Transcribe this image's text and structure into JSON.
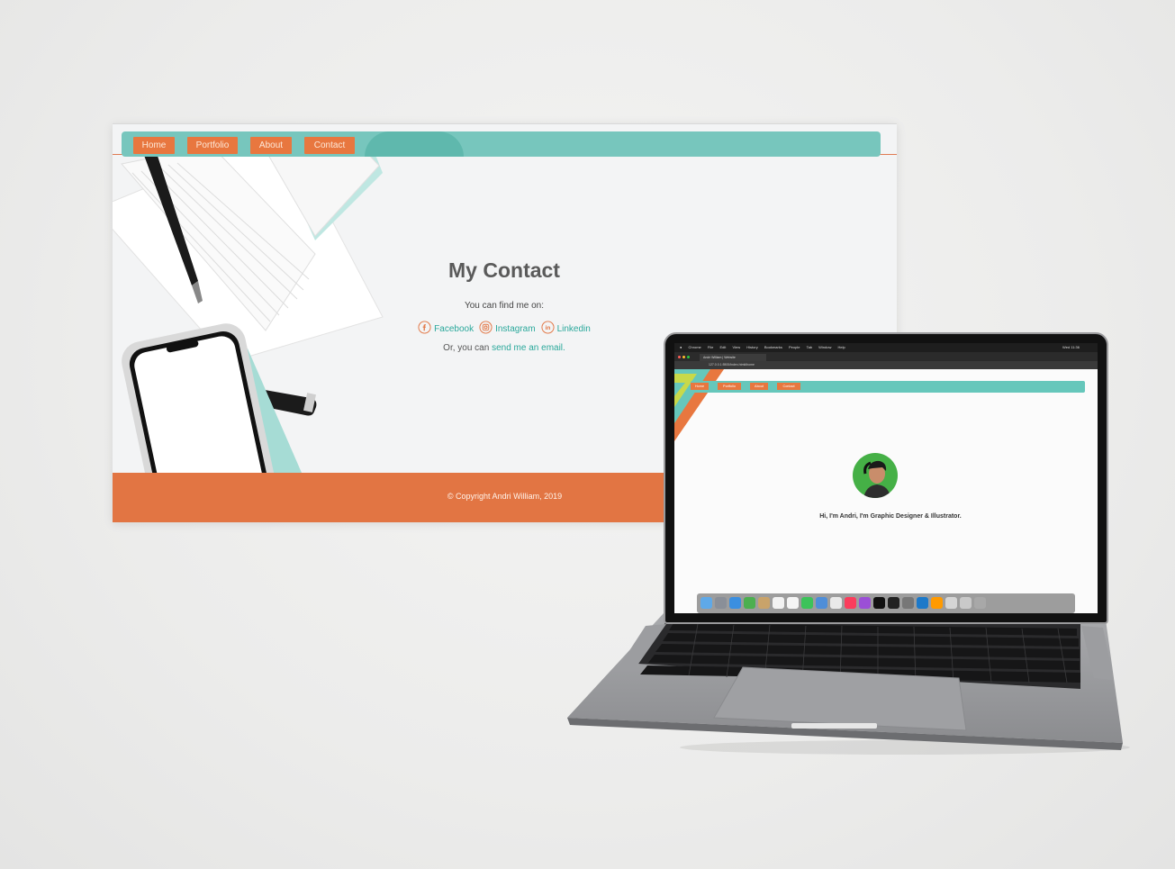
{
  "website": {
    "nav": {
      "home": "Home",
      "portfolio": "Portfolio",
      "about": "About",
      "contact": "Contact"
    },
    "contact_page": {
      "title": "My Contact",
      "find_me": "You can find me on:",
      "socials": [
        {
          "label": "Facebook",
          "icon": "facebook-icon"
        },
        {
          "label": "Instagram",
          "icon": "instagram-icon"
        },
        {
          "label": "Linkedin",
          "icon": "linkedin-icon"
        }
      ],
      "email_prefix": "Or, you can ",
      "email_link": "send me an email."
    },
    "footer": {
      "copyright": "© Copyright Andri William, 2019"
    },
    "colors": {
      "teal": "#77c6bd",
      "orange": "#e27543",
      "link": "#2aa89b"
    }
  },
  "laptop": {
    "menubar": {
      "app": "Chrome",
      "items": [
        "File",
        "Edit",
        "View",
        "History",
        "Bookmarks",
        "People",
        "Tab",
        "Window",
        "Help"
      ],
      "clock": "Wed 11:36"
    },
    "tab_title": "Andri William | Website",
    "url": "127.0.0.1:5500/index.html#home",
    "nav": {
      "home": "Home",
      "portfolio": "Portfolio",
      "about": "About",
      "contact": "Contact"
    },
    "hero": "Hi, I'm Andri, I'm Graphic Designer & Illustrator."
  }
}
